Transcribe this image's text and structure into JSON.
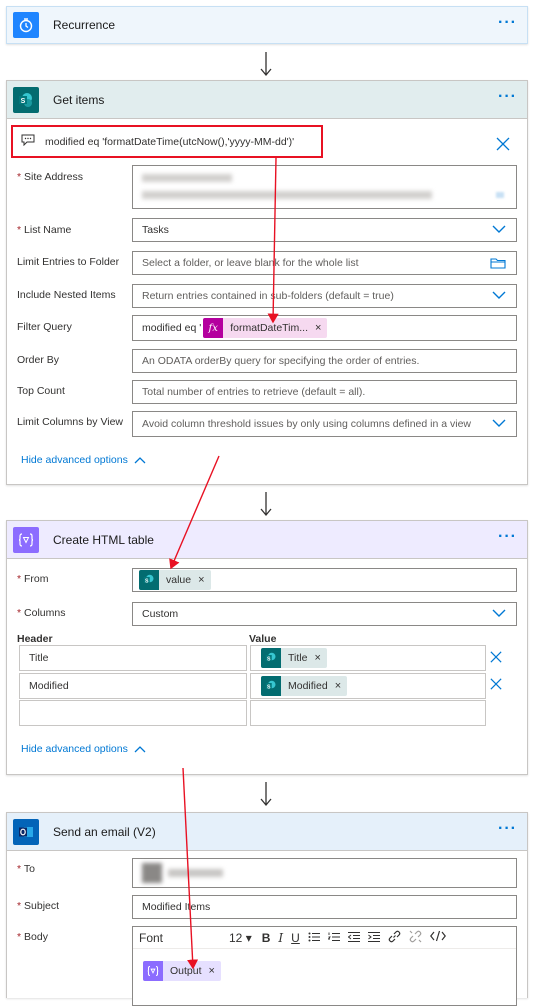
{
  "recurrence": {
    "title": "Recurrence",
    "more": "···"
  },
  "get_items": {
    "title": "Get items",
    "more": "···",
    "comment": "modified eq 'formatDateTime(utcNow(),'yyyy-MM-dd')'",
    "fields": [
      {
        "label": "Site Address",
        "required": true
      },
      {
        "label": "List Name",
        "required": true,
        "value": "Tasks"
      },
      {
        "label": "Limit Entries to Folder",
        "placeholder": "Select a folder, or leave blank for the whole list"
      },
      {
        "label": "Include Nested Items",
        "placeholder": "Return entries contained in sub-folders (default = true)"
      },
      {
        "label": "Filter Query",
        "prefix": "modified eq '",
        "token": "formatDateTim..."
      },
      {
        "label": "Order By",
        "placeholder": "An ODATA orderBy query for specifying the order of entries."
      },
      {
        "label": "Top Count",
        "placeholder": "Total number of entries to retrieve (default = all)."
      },
      {
        "label": "Limit Columns by View",
        "placeholder": "Avoid column threshold issues by only using columns defined in a view"
      }
    ],
    "hide_advanced": "Hide advanced options"
  },
  "html_table": {
    "title": "Create HTML table",
    "more": "···",
    "from_label": "From",
    "from_token": "value",
    "columns_label": "Columns",
    "columns_value": "Custom",
    "header_col": "Header",
    "value_col": "Value",
    "rows": [
      {
        "header": "Title",
        "value": "Title"
      },
      {
        "header": "Modified",
        "value": "Modified"
      }
    ],
    "hide_advanced": "Hide advanced options"
  },
  "email": {
    "title": "Send an email (V2)",
    "more": "···",
    "to_label": "To",
    "subject_label": "Subject",
    "subject_value": "Modified Items",
    "body_label": "Body",
    "font": "Font",
    "font_size": "12",
    "body_token": "Output"
  },
  "colors": {
    "recurrence_accent": "#0078d4",
    "sharepoint": "#036c70",
    "data_ops": "#8c6cff",
    "outlook": "#0364b8",
    "annotation": "#e81123"
  }
}
